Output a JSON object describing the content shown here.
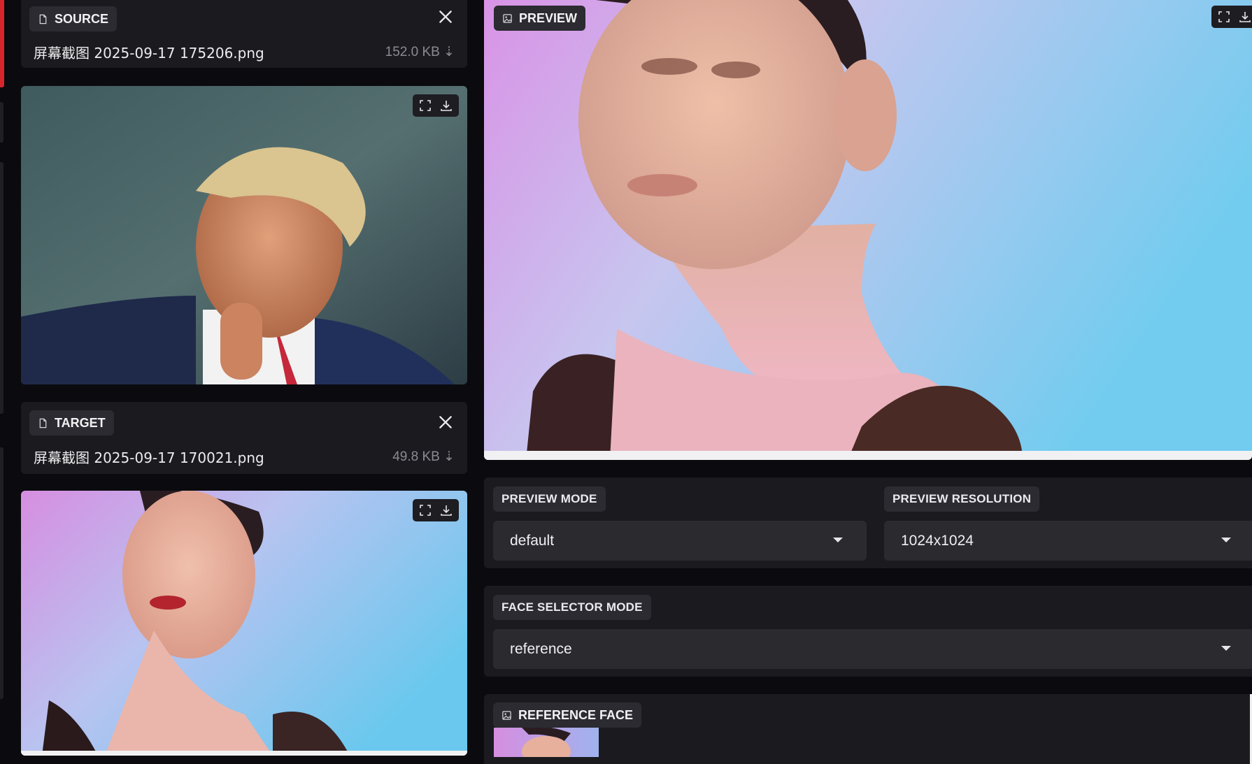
{
  "source": {
    "label": "SOURCE",
    "file_name": "屏幕截图 2025-09-17 175206.png",
    "file_size": "152.0 KB ⇣"
  },
  "target": {
    "label": "TARGET",
    "file_name": "屏幕截图 2025-09-17 170021.png",
    "file_size": "49.8 KB ⇣"
  },
  "preview": {
    "label": "PREVIEW"
  },
  "preview_mode": {
    "label": "PREVIEW MODE",
    "value": "default"
  },
  "preview_resolution": {
    "label": "PREVIEW RESOLUTION",
    "value": "1024x1024"
  },
  "face_selector_mode": {
    "label": "FACE SELECTOR MODE",
    "value": "reference"
  },
  "reference_face": {
    "label": "REFERENCE FACE"
  },
  "icons": [
    "file-icon",
    "close-icon",
    "fullscreen-icon",
    "download-icon",
    "image-icon",
    "chevron-down-icon"
  ],
  "colors": {
    "page_bg": "#0b0b0f",
    "panel_bg": "#1b1b1f",
    "pill_bg": "#2b2b31",
    "select_bg": "#2a2a2f",
    "accent_red": "#d6262b"
  }
}
